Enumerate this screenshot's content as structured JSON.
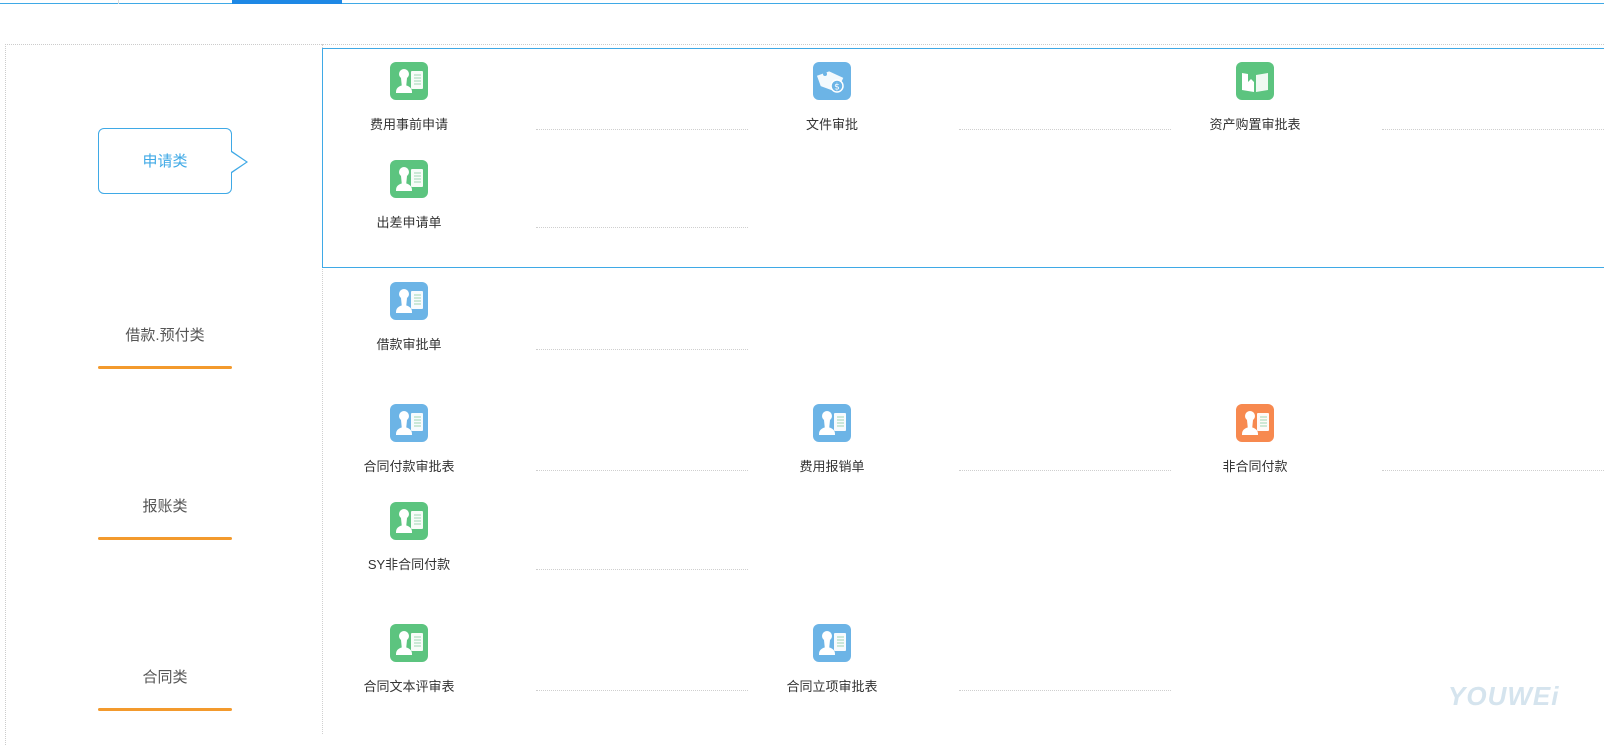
{
  "categories": [
    {
      "label": "申请类"
    },
    {
      "label": "借款.预付类"
    },
    {
      "label": "报账类"
    },
    {
      "label": "合同类"
    }
  ],
  "items": [
    {
      "label": "费用事前申请",
      "icon": "person-document-icon",
      "color": "#5cc47f"
    },
    {
      "label": "文件审批",
      "icon": "price-tag-icon",
      "color": "#6cb4e6"
    },
    {
      "label": "资产购置审批表",
      "icon": "open-book-icon",
      "color": "#5cc47f"
    },
    {
      "label": "出差申请单",
      "icon": "person-document-icon",
      "color": "#5cc47f"
    },
    {
      "label": "借款审批单",
      "icon": "person-document-icon",
      "color": "#6cb4e6"
    },
    {
      "label": "合同付款审批表",
      "icon": "person-document-icon",
      "color": "#6cb4e6"
    },
    {
      "label": "费用报销单",
      "icon": "person-document-icon",
      "color": "#6cb4e6"
    },
    {
      "label": "非合同付款",
      "icon": "person-document-icon",
      "color": "#f7894f"
    },
    {
      "label": "SY非合同付款",
      "icon": "person-document-icon",
      "color": "#5cc47f"
    },
    {
      "label": "合同文本评审表",
      "icon": "person-document-icon",
      "color": "#5cc47f"
    },
    {
      "label": "合同立项审批表",
      "icon": "person-document-icon",
      "color": "#6cb4e6"
    }
  ],
  "watermark": "YOUWEi"
}
